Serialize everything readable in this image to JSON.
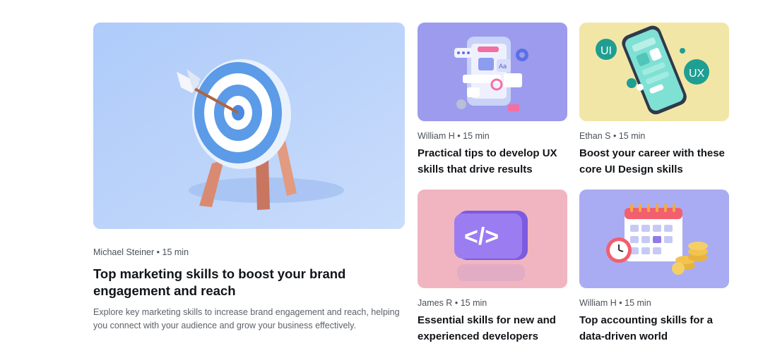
{
  "featured": {
    "author": "Michael Steiner",
    "read_time": "15 min",
    "title": "Top marketing skills to boost your brand engagement and reach",
    "description": "Explore key marketing skills to increase brand engagement and reach, helping you connect with your audience and grow your business effectively.",
    "image_subject": "target-with-arrow",
    "image_bg": "#b9d2fb"
  },
  "articles": [
    {
      "author": "William H",
      "read_time": "15 min",
      "title": "Practical tips to develop UX skills that drive results",
      "image_subject": "ux-interface-elements",
      "image_bg": "#9d9cf0"
    },
    {
      "author": "Ethan S",
      "read_time": "15 min",
      "title": "Boost your career with these core UI Design skills",
      "image_subject": "smartphone-ui-ux",
      "image_bg": "#f2e6a6",
      "badges": [
        "UI",
        "UX"
      ]
    },
    {
      "author": "James R",
      "read_time": "15 min",
      "title": "Essential skills for new and experienced developers",
      "image_subject": "code-block",
      "image_bg": "#f0b3c0",
      "code_glyph": "</>"
    },
    {
      "author": "William H",
      "read_time": "15 min",
      "title": "Top accounting skills for a data-driven world",
      "image_subject": "calendar-clock-coins",
      "image_bg": "#a8aaf2"
    }
  ],
  "separator": "•"
}
